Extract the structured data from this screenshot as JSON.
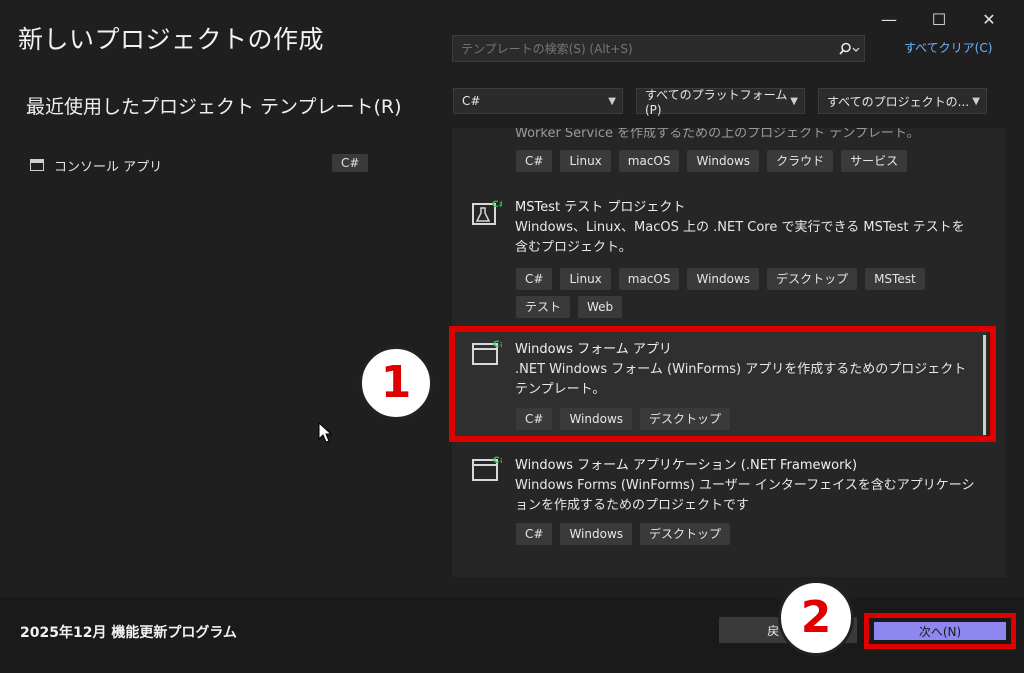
{
  "window": {
    "minimize": "—",
    "maximize": "☐",
    "close": "✕"
  },
  "header": {
    "title": "新しいプロジェクトの作成"
  },
  "recent": {
    "title": "最近使用したプロジェクト テンプレート(R)",
    "items": [
      {
        "label": "コンソール アプリ",
        "lang": "C#"
      }
    ]
  },
  "search": {
    "placeholder": "テンプレートの検索(S) (Alt+S)",
    "clear_all": "すべてクリア(C)"
  },
  "filters": {
    "language": "C#",
    "platform": "すべてのプラットフォーム(P)",
    "project_type": "すべてのプロジェクトの..."
  },
  "templates": [
    {
      "name_partial": "Worker Service を作成するための上のプロジェクト テンプレート。",
      "tags": [
        "C#",
        "Linux",
        "macOS",
        "Windows",
        "クラウド",
        "サービス"
      ]
    },
    {
      "name": "MSTest テスト プロジェクト",
      "desc": "Windows、Linux、MacOS 上の .NET Core で実行できる MSTest テストを含むプロジェクト。",
      "tags": [
        "C#",
        "Linux",
        "macOS",
        "Windows",
        "デスクトップ",
        "MSTest",
        "テスト",
        "Web"
      ]
    },
    {
      "name": "Windows フォーム アプリ",
      "desc": ".NET Windows フォーム (WinForms) アプリを作成するためのプロジェクト テンプレート。",
      "tags": [
        "C#",
        "Windows",
        "デスクトップ"
      ]
    },
    {
      "name": "Windows フォーム アプリケーション (.NET Framework)",
      "desc": "Windows Forms (WinForms) ユーザー インターフェイスを含むアプリケーションを作成するためのプロジェクトです",
      "tags": [
        "C#",
        "Windows",
        "デスクトップ"
      ]
    }
  ],
  "annotations": {
    "step1": "1",
    "step2": "2",
    "color": "#e00000"
  },
  "footer": {
    "update_text": "2025年12月 機能更新プログラム",
    "back_label": "戻る(B)",
    "next_label": "次へ(N)"
  },
  "colors": {
    "background": "#1f1f1f",
    "accent_link": "#6fb3ff",
    "primary_button": "#8f87f0",
    "icon_green": "#3fbf5f"
  }
}
